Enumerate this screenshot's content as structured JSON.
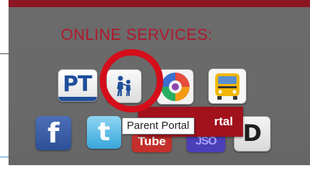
{
  "section": {
    "heading": "ONLINE SERVICES:"
  },
  "services": {
    "pt_label": "PT",
    "facebook_label": "f",
    "twitter_label": "t",
    "youtube_label": "Tube",
    "blue_label": "JSO",
    "d_label": "D"
  },
  "portal_banner": {
    "text": "rtal"
  },
  "tooltip": {
    "text": "Parent Portal"
  },
  "colors": {
    "panel_bg": "#6a6a6a",
    "top_bar": "#8b1521",
    "heading": "#b2182b",
    "highlight_circle": "#d40e1a",
    "portal_banner": "#a1121d"
  },
  "icons": {
    "parent_portal": "walking-parent-child-icon",
    "swirl": "color-swirl-icon",
    "bus": "school-bus-icon"
  }
}
